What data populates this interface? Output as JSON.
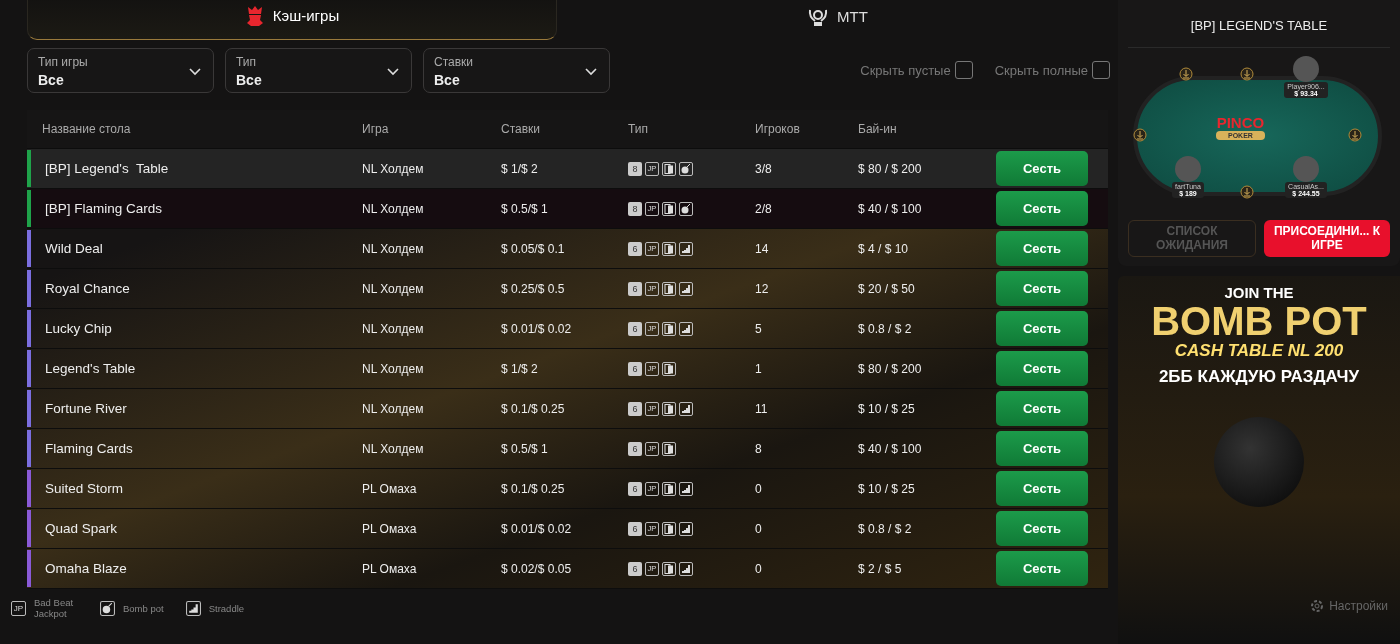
{
  "tabs": [
    {
      "label": "Кэш-игры",
      "kind": "cash",
      "selected": true
    },
    {
      "label": "MTT",
      "kind": "mtt",
      "selected": false
    }
  ],
  "filters": [
    {
      "label": "Тип игры",
      "value": "Все"
    },
    {
      "label": "Тип",
      "value": "Все"
    },
    {
      "label": "Ставки",
      "value": "Все"
    }
  ],
  "toggles": [
    {
      "label": "Скрыть пустые",
      "checked": false
    },
    {
      "label": "Скрыть полные",
      "checked": false
    }
  ],
  "table": {
    "columns": [
      "Название стола",
      "Игра",
      "Ставки",
      "Тип",
      "Игроков",
      "Бай-ин"
    ],
    "rows": [
      {
        "name": "[BP] Legend's  Table",
        "game": "NL Холдем",
        "stakes": "$ 1/$ 2",
        "seats": "8",
        "features": [
          {
            "kind": "jackpot",
            "label": "JP"
          },
          {
            "kind": "cards"
          },
          {
            "kind": "bomb"
          }
        ],
        "players": "3/8",
        "buyin": "$ 80 / $ 200",
        "action": "Сесть",
        "color": "#1fa34a",
        "selected": true
      },
      {
        "name": "[BP] Flaming Cards",
        "game": "NL Холдем",
        "stakes": "$ 0.5/$ 1",
        "seats": "8",
        "features": [
          {
            "kind": "jackpot",
            "label": "JP"
          },
          {
            "kind": "cards"
          },
          {
            "kind": "bomb"
          }
        ],
        "players": "2/8",
        "buyin": "$ 40 / $ 100",
        "action": "Сесть",
        "color": "#1fa34a",
        "selected": false
      },
      {
        "name": "Wild Deal",
        "game": "NL Холдем",
        "stakes": "$ 0.05/$ 0.1",
        "seats": "6",
        "features": [
          {
            "kind": "jackpot",
            "label": "JP"
          },
          {
            "kind": "cards"
          },
          {
            "kind": "straddle"
          }
        ],
        "players": "14",
        "buyin": "$ 4 / $ 10",
        "action": "Сесть",
        "color": "#7b6ee0",
        "selected": false
      },
      {
        "name": "Royal Chance",
        "game": "NL Холдем",
        "stakes": "$ 0.25/$ 0.5",
        "seats": "6",
        "features": [
          {
            "kind": "jackpot",
            "label": "JP"
          },
          {
            "kind": "cards"
          },
          {
            "kind": "straddle"
          }
        ],
        "players": "12",
        "buyin": "$ 20 / $ 50",
        "action": "Сесть",
        "color": "#7b6ee0",
        "selected": false
      },
      {
        "name": "Lucky Chip",
        "game": "NL Холдем",
        "stakes": "$ 0.01/$ 0.02",
        "seats": "6",
        "features": [
          {
            "kind": "jackpot",
            "label": "JP"
          },
          {
            "kind": "cards"
          },
          {
            "kind": "straddle"
          }
        ],
        "players": "5",
        "buyin": "$ 0.8 / $ 2",
        "action": "Сесть",
        "color": "#7b6ee0",
        "selected": false
      },
      {
        "name": "Legend's Table",
        "game": "NL Холдем",
        "stakes": "$ 1/$ 2",
        "seats": "6",
        "features": [
          {
            "kind": "jackpot",
            "label": "JP"
          },
          {
            "kind": "cards"
          }
        ],
        "players": "1",
        "buyin": "$ 80 / $ 200",
        "action": "Сесть",
        "color": "#7b6ee0",
        "selected": false
      },
      {
        "name": "Fortune River",
        "game": "NL Холдем",
        "stakes": "$ 0.1/$ 0.25",
        "seats": "6",
        "features": [
          {
            "kind": "jackpot",
            "label": "JP"
          },
          {
            "kind": "cards"
          },
          {
            "kind": "straddle"
          }
        ],
        "players": "11",
        "buyin": "$ 10 / $ 25",
        "action": "Сесть",
        "color": "#7b6ee0",
        "selected": false
      },
      {
        "name": "Flaming Cards",
        "game": "NL Холдем",
        "stakes": "$ 0.5/$ 1",
        "seats": "6",
        "features": [
          {
            "kind": "jackpot",
            "label": "JP"
          },
          {
            "kind": "cards"
          }
        ],
        "players": "8",
        "buyin": "$ 40 / $ 100",
        "action": "Сесть",
        "color": "#7b6ee0",
        "selected": false
      },
      {
        "name": "Suited Storm",
        "game": "PL Омаха",
        "stakes": "$ 0.1/$ 0.25",
        "seats": "6",
        "features": [
          {
            "kind": "jackpot",
            "label": "JP"
          },
          {
            "kind": "cards"
          },
          {
            "kind": "straddle"
          }
        ],
        "players": "0",
        "buyin": "$ 10 / $ 25",
        "action": "Сесть",
        "color": "#8a5ad8",
        "selected": false
      },
      {
        "name": "Quad Spark",
        "game": "PL Омаха",
        "stakes": "$ 0.01/$ 0.02",
        "seats": "6",
        "features": [
          {
            "kind": "jackpot",
            "label": "JP"
          },
          {
            "kind": "cards"
          },
          {
            "kind": "straddle"
          }
        ],
        "players": "0",
        "buyin": "$ 0.8 / $ 2",
        "action": "Сесть",
        "color": "#8a5ad8",
        "selected": false
      },
      {
        "name": "Omaha Blaze",
        "game": "PL Омаха",
        "stakes": "$ 0.02/$ 0.05",
        "seats": "6",
        "features": [
          {
            "kind": "jackpot",
            "label": "JP"
          },
          {
            "kind": "cards"
          },
          {
            "kind": "straddle"
          }
        ],
        "players": "0",
        "buyin": "$ 2 / $ 5",
        "action": "Сесть",
        "color": "#8a5ad8",
        "selected": false
      }
    ]
  },
  "legend": [
    {
      "kind": "jackpot",
      "icon": "JP",
      "label": "Bad Beat Jackpot"
    },
    {
      "kind": "bomb",
      "label": "Bomb pot"
    },
    {
      "kind": "straddle",
      "label": "Straddle"
    }
  ],
  "preview": {
    "title": "[BP] LEGEND'S TABLE",
    "logo": "PINCO",
    "logo_sub": "POKER",
    "players": [
      {
        "name": "Player906...",
        "stack": "$ 93.34"
      },
      {
        "name": "fartTuna",
        "stack": "$ 189"
      },
      {
        "name": "CasualAs...",
        "stack": "$ 244.55"
      }
    ],
    "buttons": [
      {
        "label": "СПИСОК ОЖИДАНИЯ",
        "kind": "secondary",
        "disabled": true
      },
      {
        "label": "ПРИСОЕДИНИ... К ИГРЕ",
        "kind": "primary",
        "disabled": false
      }
    ]
  },
  "banner": {
    "lines": [
      "JOIN THE",
      "BOMB POT",
      "CASH TABLE  NL 200",
      "2ББ КАЖДУЮ РАЗДАЧУ"
    ]
  },
  "settings": {
    "label": "Настройки"
  }
}
